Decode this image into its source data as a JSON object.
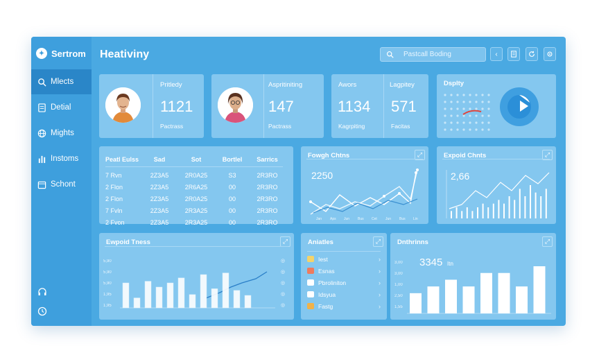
{
  "app": {
    "brand": "Sertrom",
    "title": "Heativiny"
  },
  "sidebar": {
    "items": [
      {
        "label": "Mlects",
        "icon": "search-icon",
        "active": true
      },
      {
        "label": "Detial",
        "icon": "document-icon"
      },
      {
        "label": "Mights",
        "icon": "globe-icon"
      },
      {
        "label": "Instoms",
        "icon": "bar-chart-icon"
      },
      {
        "label": "Schont",
        "icon": "calendar-icon"
      }
    ],
    "bottom_icons": [
      "headset-icon",
      "clock-icon"
    ]
  },
  "search": {
    "placeholder": "Pastcall Boding"
  },
  "toolbar_icons": [
    "chevron-left-icon",
    "bookmark-icon",
    "refresh-icon",
    "settings-icon"
  ],
  "stats": [
    {
      "label": "Pritledy",
      "value": "1121",
      "sub": "Pactrass"
    },
    {
      "label": "Aspritiniting",
      "value": "147",
      "sub": "Pactrass"
    },
    {
      "label": "Awors",
      "value": "1134",
      "sub": "Kagrpiting"
    },
    {
      "label": "Lagpitey",
      "value": "571",
      "sub": "Facitas"
    }
  ],
  "display_card": {
    "title": "Dsplty"
  },
  "table": {
    "columns": [
      "Peatl Eulss",
      "Sad",
      "Sot",
      "Bortlel",
      "Sarrics"
    ],
    "rows": [
      [
        "7 Rvn",
        "2Z3A5",
        "2R0A25",
        "S3",
        "2R3RO"
      ],
      [
        "2 Flon",
        "2Z3A5",
        "2R6A25",
        "00",
        "2R3RO"
      ],
      [
        "2 Flon",
        "2Z3A5",
        "2R0A25",
        "00",
        "2R3RO"
      ],
      [
        "7 Fvln",
        "2Z3A5",
        "2R3A25",
        "00",
        "2R3RO"
      ],
      [
        "2 Fvon",
        "2Z3A5",
        "2R3A25",
        "00",
        "2R3RO"
      ]
    ]
  },
  "line_card": {
    "title": "Fowgh Chtns",
    "value": "2250",
    "x_labels": [
      "Jan",
      "Aps",
      "Jun",
      "Bus",
      "Cet",
      "Jun",
      "Bus",
      "Lin"
    ]
  },
  "spark_card": {
    "title": "Expoid Chnts",
    "value": "2,66"
  },
  "bottom_chart": {
    "title": "Ewpoid Tness",
    "y_labels_left": [
      "5,90",
      "5,90",
      "5,90",
      "1,95",
      "1,95"
    ],
    "y_labels_right": [
      "◎",
      "◎",
      "◎",
      "◎",
      "◎"
    ]
  },
  "activity_card": {
    "title": "Aniatles",
    "items": [
      "Iest",
      "Esnas",
      "Pbroliniton",
      "Idsyua",
      "Fastg"
    ]
  },
  "dist_card": {
    "title": "Dnthrinns",
    "value": "3345",
    "unit": "Itn",
    "y_labels": [
      "3,00",
      "3,00",
      "1,00",
      "2,50",
      "1,55"
    ]
  },
  "chart_data": [
    {
      "type": "bar",
      "title": "Expoid Chnts",
      "values": [
        2,
        3,
        2,
        3,
        2,
        3,
        4,
        3,
        4,
        5,
        4,
        6,
        5,
        8,
        6,
        9,
        7,
        6,
        8
      ]
    },
    {
      "type": "bar",
      "title": "Ewpoid Tness",
      "values": [
        3,
        1.2,
        3.2,
        2.5,
        3,
        3.6,
        1.6,
        4,
        2.3,
        4.2,
        2.1,
        1.5
      ]
    },
    {
      "type": "bar",
      "title": "Dnthrinns",
      "values": [
        3,
        4,
        5,
        4,
        6,
        6,
        4,
        7
      ]
    }
  ],
  "colors": {
    "window_bg": "#4aa9e2",
    "sidebar_bg": "#3e9fdd",
    "card_bg": "#84c7ef",
    "active_nav": "#2a86c8",
    "accent_red": "#e0463d"
  }
}
